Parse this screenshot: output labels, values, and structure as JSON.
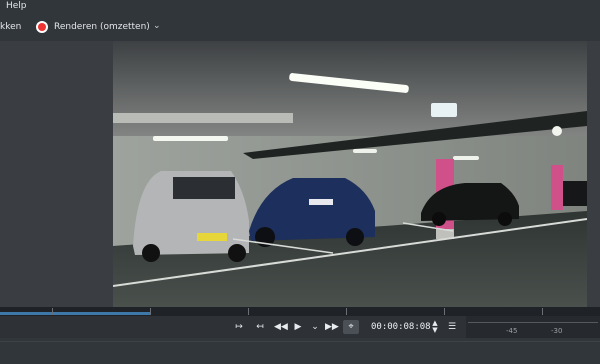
{
  "menubar": {
    "items": [
      {
        "label": "Help"
      }
    ]
  },
  "toolbar": {
    "partial_label": "kken",
    "render_label": "Renderen (omzetten)",
    "render_icon": "record-icon",
    "dropdown_icon": "chevron-down-icon"
  },
  "player": {
    "timecode": "00:00:08:08",
    "buttons": [
      {
        "name": "set-zone-in-button",
        "icon": "zone-in-icon"
      },
      {
        "name": "set-zone-out-button",
        "icon": "zone-out-icon"
      },
      {
        "name": "rewind-button",
        "icon": "rewind-icon"
      },
      {
        "name": "play-button",
        "icon": "play-icon"
      },
      {
        "name": "play-options-button",
        "icon": "chevron-down-icon"
      },
      {
        "name": "forward-button",
        "icon": "fast-forward-icon"
      },
      {
        "name": "crop-button",
        "icon": "crop-icon"
      },
      {
        "name": "timecode-stepper",
        "icon": "up-down-icon"
      },
      {
        "name": "monitor-menu-button",
        "icon": "hamburger-icon"
      }
    ],
    "progress_fraction": 0.25
  },
  "audio_meter": {
    "scale_labels": [
      "-45",
      "-30"
    ]
  },
  "colors": {
    "accent": "#3d78a8",
    "record": "#e33333",
    "pillar": "#d0508a"
  }
}
